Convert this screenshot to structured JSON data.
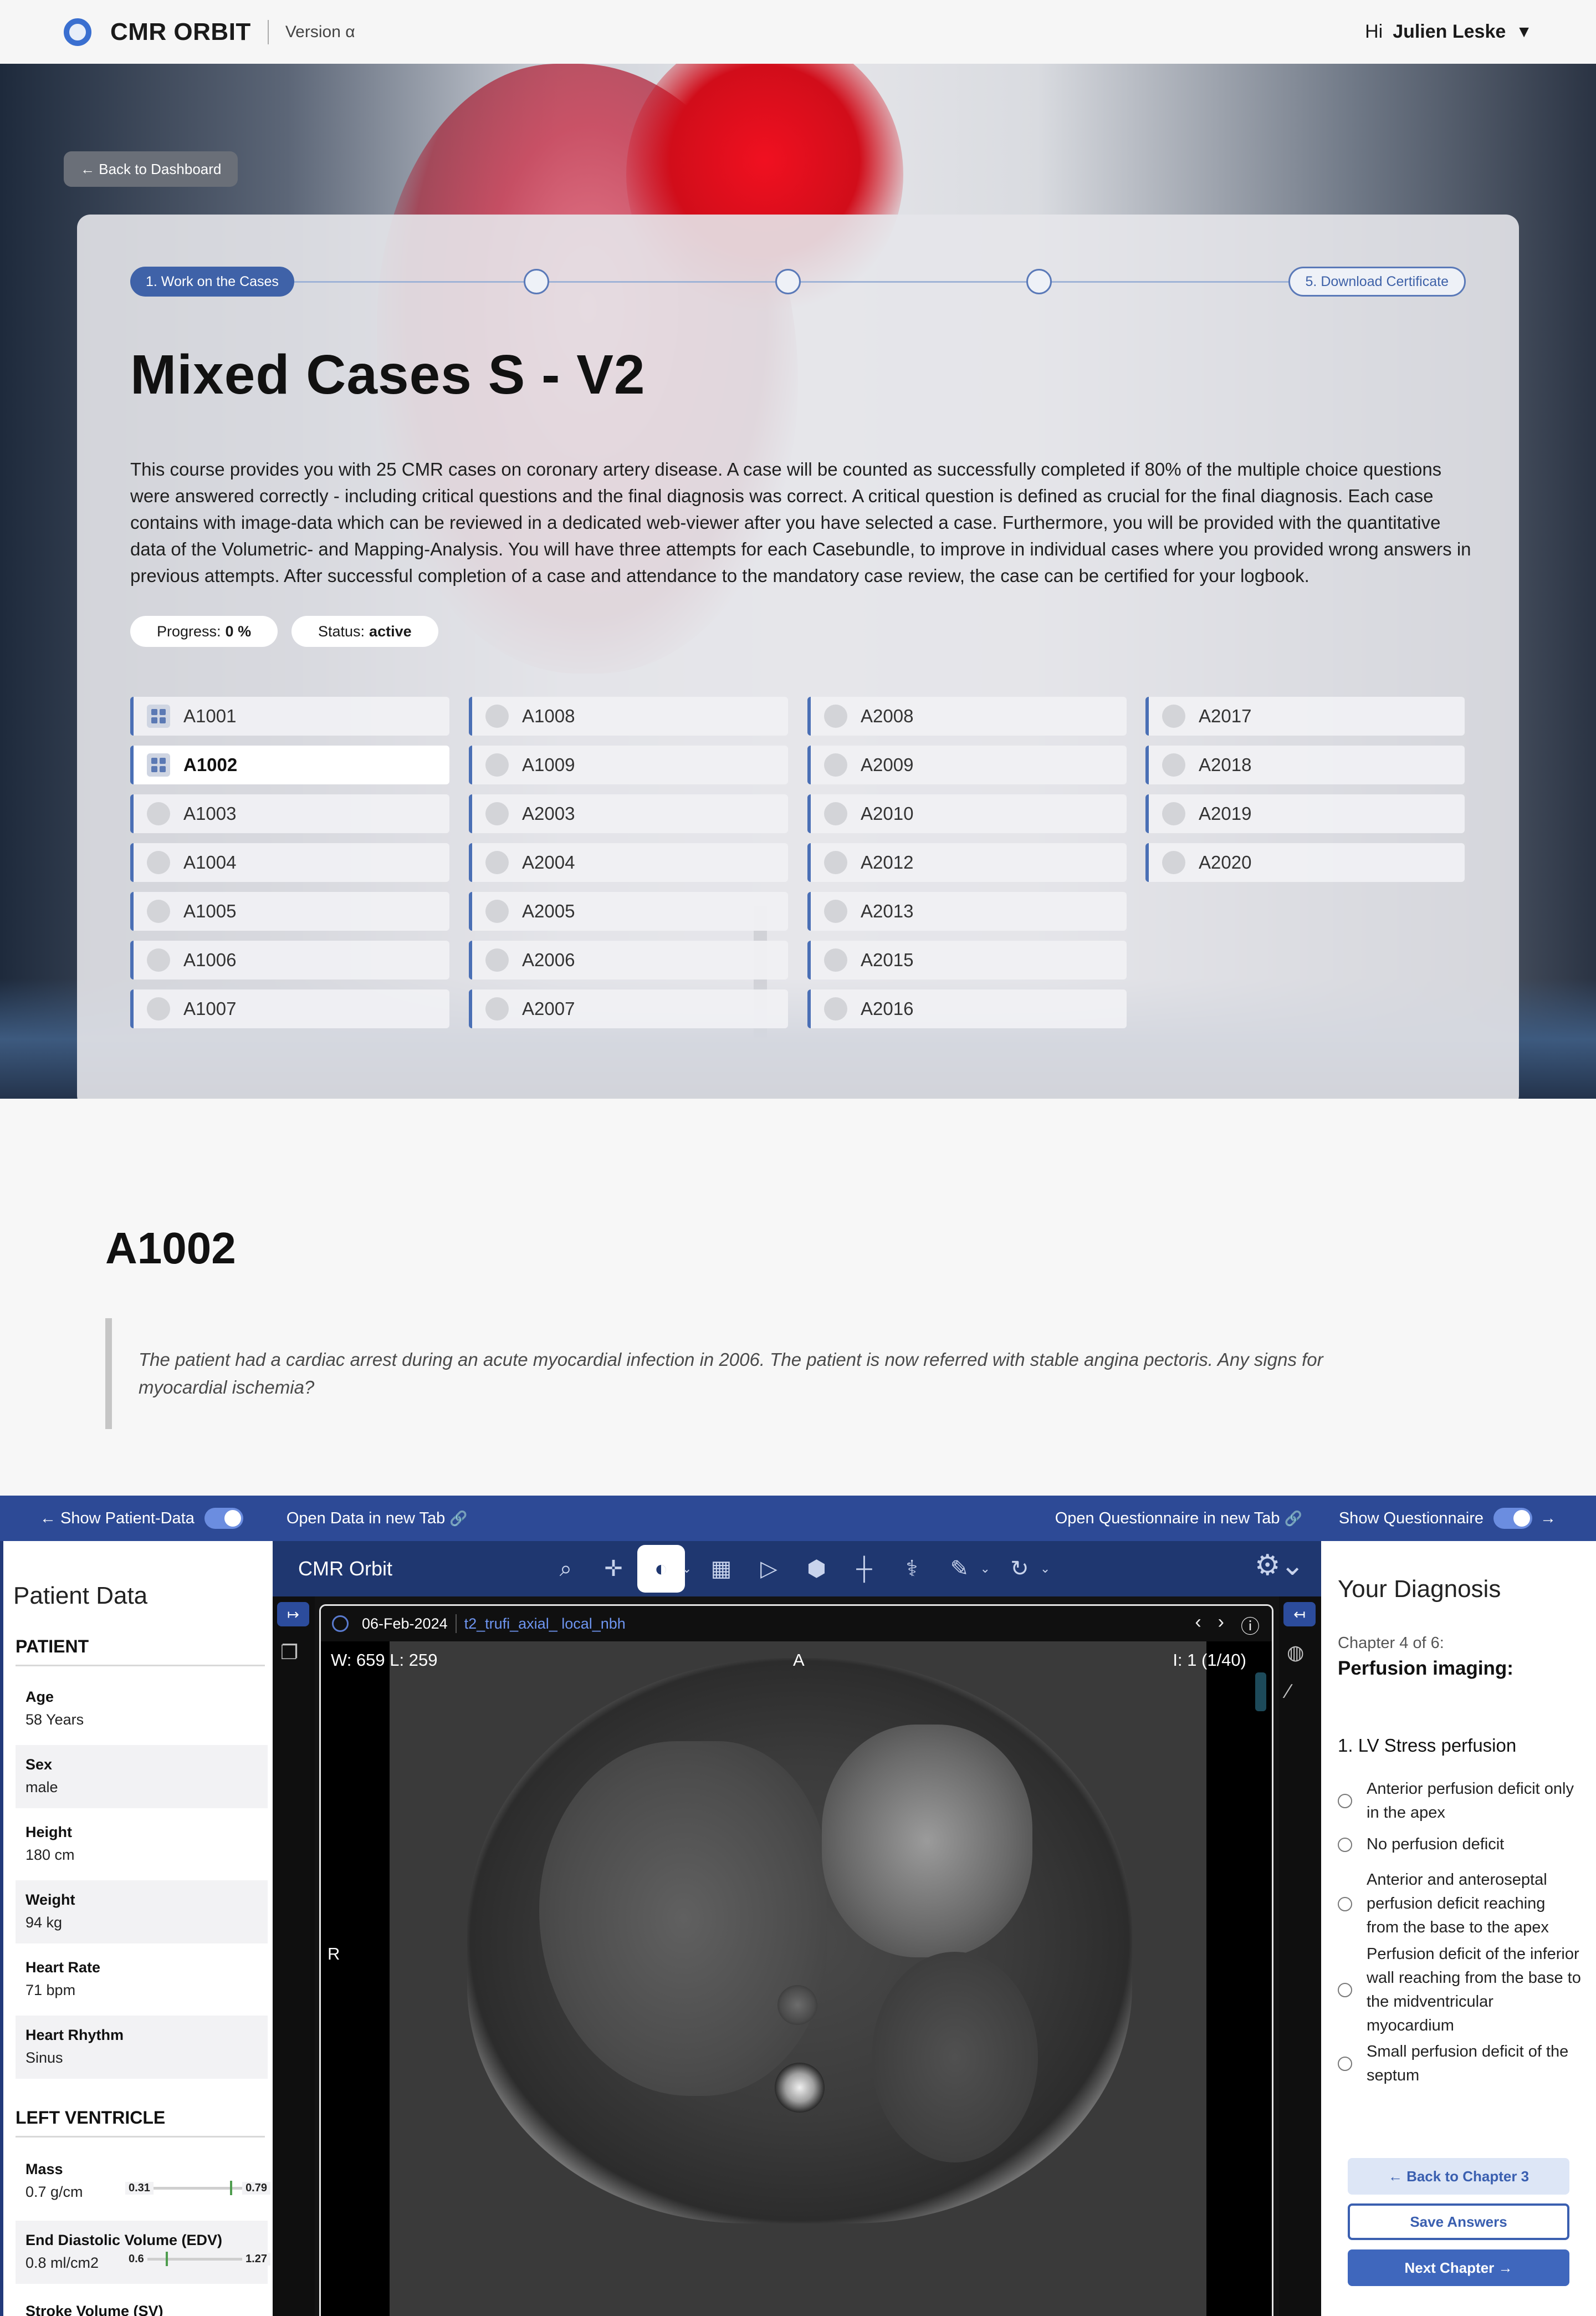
{
  "header": {
    "brand": "CMR ORBIT",
    "version": "Version α",
    "greeting": "Hi",
    "user_name": "Julien Leske",
    "caret": "▼"
  },
  "back_to_dashboard": "← Back to Dashboard",
  "stepper": {
    "first": "1. Work on the Cases",
    "last": "5. Download Certificate"
  },
  "course": {
    "title": "Mixed Cases S - V2",
    "description": "This course provides you with 25 CMR cases on coronary artery disease. A case will be counted as successfully completed if 80% of the multiple choice questions were answered correctly - including critical questions and the final diagnosis was correct. A critical question is defined as crucial for the final diagnosis. Each case contains with image-data which can be reviewed in a dedicated web-viewer after you have selected a case. Furthermore, you will be provided with the quantitative data of the Volumetric- and Mapping-Analysis. You will have three attempts for each Casebundle, to improve in individual cases where you provided wrong answers in previous attempts. After successful completion of a case and attendance to the mandatory case review, the case can be certified for your logbook.",
    "progress_label": "Progress:",
    "progress_value": "0 %",
    "status_label": "Status:",
    "status_value": "active"
  },
  "cases": {
    "col1": [
      "A1001",
      "A1002",
      "A1003",
      "A1004",
      "A1005",
      "A1006",
      "A1007"
    ],
    "col2": [
      "A1008",
      "A1009",
      "A2003",
      "A2004",
      "A2005",
      "A2006",
      "A2007"
    ],
    "col3": [
      "A2008",
      "A2009",
      "A2010",
      "A2012",
      "A2013",
      "A2015",
      "A2016"
    ],
    "col4": [
      "A2017",
      "A2018",
      "A2019",
      "A2020"
    ],
    "selected": "A1002"
  },
  "case_detail": {
    "id": "A1002",
    "history": "The patient had a cardiac arrest during an acute myocardial infection in 2006. The patient is now referred with stable angina pectoris. Any signs for myocardial ischemia?"
  },
  "viewer_bar": {
    "show_patient_data": "← Show Patient-Data",
    "open_data_tab": "Open Data in new Tab",
    "open_questionnaire_tab": "Open Questionnaire in new Tab",
    "show_questionnaire": "Show Questionnaire",
    "arrow_right": "→",
    "link_icon": "🔗"
  },
  "patient_data": {
    "title": "Patient Data",
    "section_patient": "PATIENT",
    "rows": [
      {
        "label": "Age",
        "value": "58 Years"
      },
      {
        "label": "Sex",
        "value": "male"
      },
      {
        "label": "Height",
        "value": "180 cm"
      },
      {
        "label": "Weight",
        "value": "94 kg"
      },
      {
        "label": "Heart Rate",
        "value": "71 bpm"
      },
      {
        "label": "Heart Rhythm",
        "value": "Sinus"
      }
    ],
    "section_lv": "LEFT VENTRICLE",
    "lv_rows": [
      {
        "label": "Mass",
        "value": "0.7 g/cm",
        "range_low": "0.31",
        "range_high": "0.79",
        "marker_fraction": 0.72
      },
      {
        "label": "End Diastolic Volume (EDV)",
        "value": "0.8 ml/cm2",
        "range_low": "0.6",
        "range_high": "1.27",
        "marker_fraction": 0.28
      },
      {
        "label": "Stroke Volume (SV)",
        "value": ""
      }
    ]
  },
  "viewer": {
    "title": "CMR Orbit",
    "study_date": "06-Feb-2024",
    "series": "t2_trufi_axial_ local_nbh",
    "window": "W:  659  L:  259",
    "orientation_top": "A",
    "orientation_left": "R",
    "instance": "I: 1 (1/40)",
    "tools": [
      "search-icon",
      "pan-icon",
      "contrast-icon",
      "layout-icon",
      "play-icon",
      "cube-icon",
      "crosshair-icon",
      "probe-icon",
      "measure-icon",
      "rotate-icon",
      "settings-icon"
    ]
  },
  "diagnosis": {
    "title": "Your Diagnosis",
    "chapter": "Chapter 4 of 6:",
    "chapter_name": "Perfusion imaging:",
    "question": "1. LV Stress perfusion",
    "options": [
      "Anterior perfusion deficit only in the apex",
      "No perfusion deficit",
      "Anterior and anteroseptal perfusion deficit reaching from the base to the apex",
      "Perfusion deficit of the inferior wall reaching from the base to the midventricular myocardium",
      "Small perfusion deficit of the septum"
    ],
    "back_button": "← Back to Chapter 3",
    "save_button": "Save Answers",
    "next_button": "Next Chapter →"
  }
}
